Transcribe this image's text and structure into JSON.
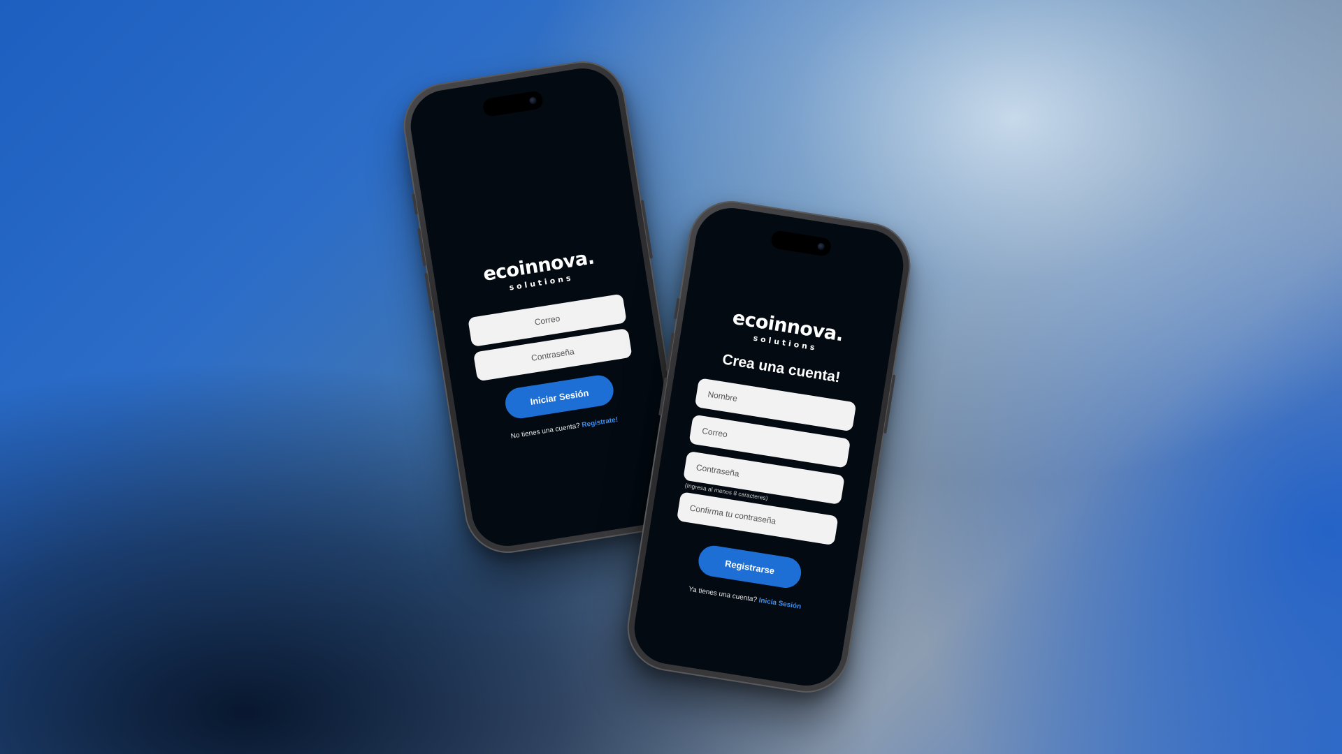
{
  "login_screen": {
    "brand": "ecoinnova.",
    "brand_sub": "solutions",
    "email_placeholder": "Correo",
    "password_placeholder": "Contraseña",
    "submit_label": "Iniciar Sesión",
    "footer_text": "No tienes una cuenta?",
    "footer_link": "Registrate!"
  },
  "register_screen": {
    "brand": "ecoinnova.",
    "brand_sub": "solutions",
    "heading": "Crea una cuenta!",
    "name_placeholder": "Nombre",
    "email_placeholder": "Correo",
    "password_placeholder": "Contraseña",
    "password_hint": "(Ingresa al menos 8 caracteres)",
    "confirm_placeholder": "Confirma tu contraseña",
    "submit_label": "Registrarse",
    "footer_text": "Ya tienes una cuenta?",
    "footer_link": "Inicia Sesión"
  },
  "colors": {
    "accent": "#1d6fd6",
    "link": "#3d8ff0",
    "screen_bg": "#030a12",
    "field_bg": "#f2f2f3"
  }
}
